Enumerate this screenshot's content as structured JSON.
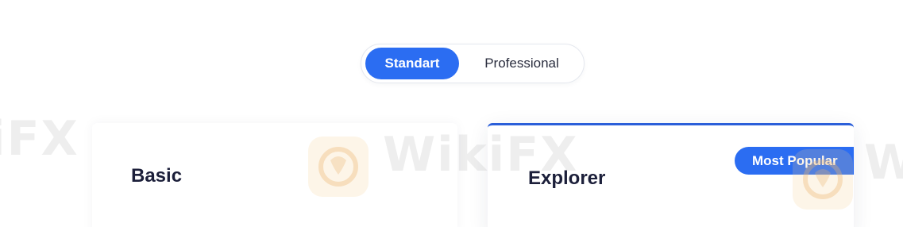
{
  "plan_toggle": {
    "options": [
      {
        "label": "Standart",
        "active": true
      },
      {
        "label": "Professional",
        "active": false
      }
    ]
  },
  "cards": [
    {
      "title": "Basic"
    },
    {
      "title": "Explorer",
      "badge": "Most Popular",
      "highlighted": true
    }
  ],
  "watermark": {
    "text_left": "iFX",
    "text_center": "WikiFX",
    "text_right": "W"
  },
  "colors": {
    "accent": "#2b6df2",
    "card_top_border": "#2b5fd9",
    "title_text": "#1c1f3a",
    "page_background": "#ffffff"
  }
}
